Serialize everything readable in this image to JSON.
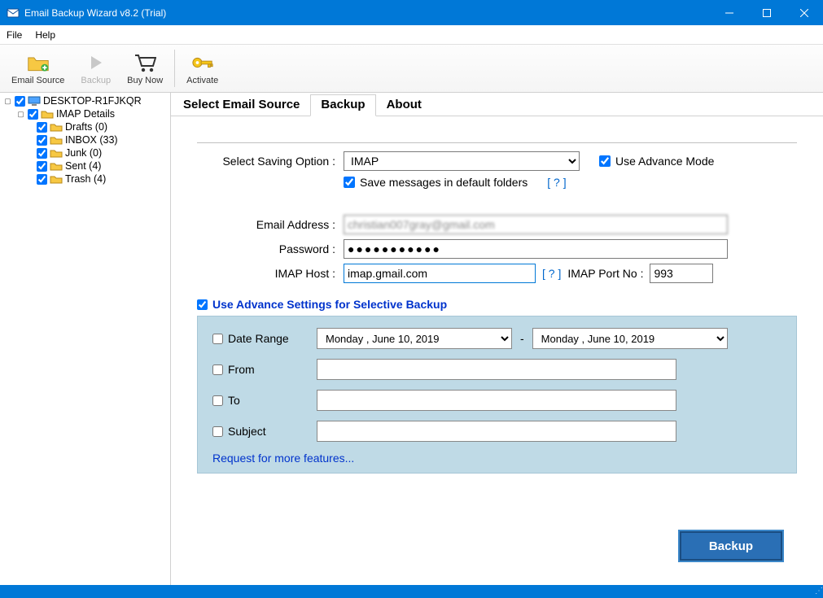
{
  "window": {
    "title": "Email Backup Wizard v8.2 (Trial)"
  },
  "menu": {
    "file": "File",
    "help": "Help"
  },
  "toolbar": {
    "email_source": "Email Source",
    "backup": "Backup",
    "buy_now": "Buy Now",
    "activate": "Activate"
  },
  "tree": {
    "root": "DESKTOP-R1FJKQR",
    "imap_details": "IMAP Details",
    "folders": [
      "Drafts (0)",
      "INBOX (33)",
      "Junk (0)",
      "Sent (4)",
      "Trash (4)"
    ]
  },
  "tabs": {
    "select_source": "Select Email Source",
    "backup": "Backup",
    "about": "About"
  },
  "form": {
    "saving_option_label": "Select Saving Option :",
    "saving_option_value": "IMAP",
    "use_advance_mode": "Use Advance Mode",
    "save_default": "Save messages in default folders",
    "help": "[ ? ]",
    "email_label": "Email Address :",
    "email_value": "christian007gray@gmail.com",
    "password_label": "Password :",
    "password_value": "●●●●●●●●●●●",
    "imap_host_label": "IMAP Host :",
    "imap_host_value": "imap.gmail.com",
    "imap_port_label": "IMAP Port No :",
    "imap_port_value": "993"
  },
  "advance": {
    "header": "Use Advance Settings for Selective Backup",
    "date_range": "Date Range",
    "date_from": "Monday   ,     June     10, 2019",
    "date_to": "Monday   ,     June     10, 2019",
    "from": "From",
    "to": "To",
    "subject": "Subject",
    "more_link": "Request for more features..."
  },
  "buttons": {
    "backup": "Backup"
  }
}
